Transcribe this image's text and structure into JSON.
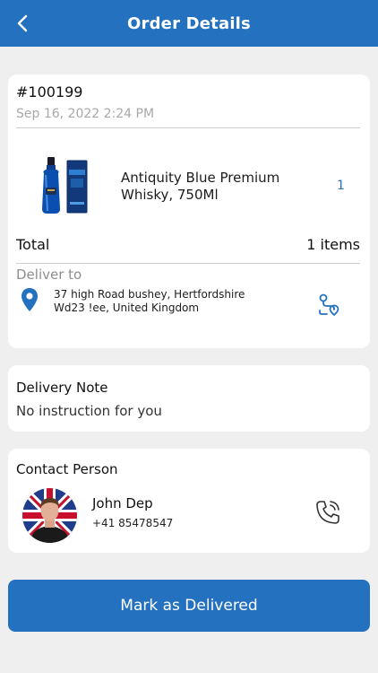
{
  "header": {
    "title": "Order Details",
    "back_icon": "chevron-left-icon"
  },
  "order": {
    "id": "#100199",
    "date": "Sep 16, 2022 2:24 PM",
    "product": {
      "name": "Antiquity Blue Premium Whisky, 750Ml",
      "quantity": "1",
      "image": "whisky-bottle-image"
    },
    "total_label": "Total",
    "total_items": "1 items",
    "deliver_label": "Deliver to",
    "address": "37 high Road bushey, Hertfordshire Wd23 !ee, United Kingdom",
    "route_icon": "route-icon",
    "pin_icon": "map-pin-icon"
  },
  "delivery_note": {
    "title": "Delivery Note",
    "text": "No instruction for you"
  },
  "contact": {
    "title": "Contact Person",
    "name": "John Dep",
    "phone": "+41 85478547",
    "call_icon": "phone-call-icon"
  },
  "actions": {
    "mark_delivered": "Mark as Delivered"
  },
  "colors": {
    "primary": "#2472bf",
    "background": "#efefef",
    "card": "#ffffff",
    "muted": "#a8a8a8",
    "qty": "#2a73b9"
  }
}
